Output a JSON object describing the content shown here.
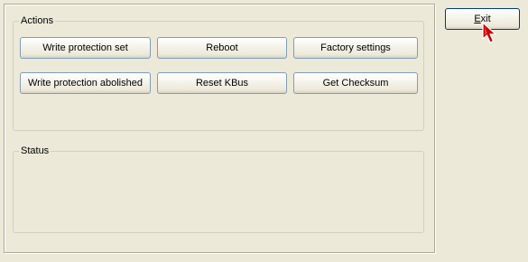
{
  "actions": {
    "legend": "Actions",
    "buttons": [
      {
        "label": "Write protection set"
      },
      {
        "label": "Reboot"
      },
      {
        "label": "Factory settings"
      },
      {
        "label": "Write protection abolished"
      },
      {
        "label": "Reset KBus"
      },
      {
        "label": "Get Checksum"
      }
    ]
  },
  "status": {
    "legend": "Status",
    "text": ""
  },
  "exit_button": {
    "mnemonic": "E",
    "rest": "xit"
  },
  "cursor": {
    "icon": "arrow-cursor-icon",
    "color": "#cc0000"
  },
  "colors": {
    "background": "#ece9d8",
    "button_border": "#7f9db9",
    "group_border": "#d0d0bf"
  }
}
